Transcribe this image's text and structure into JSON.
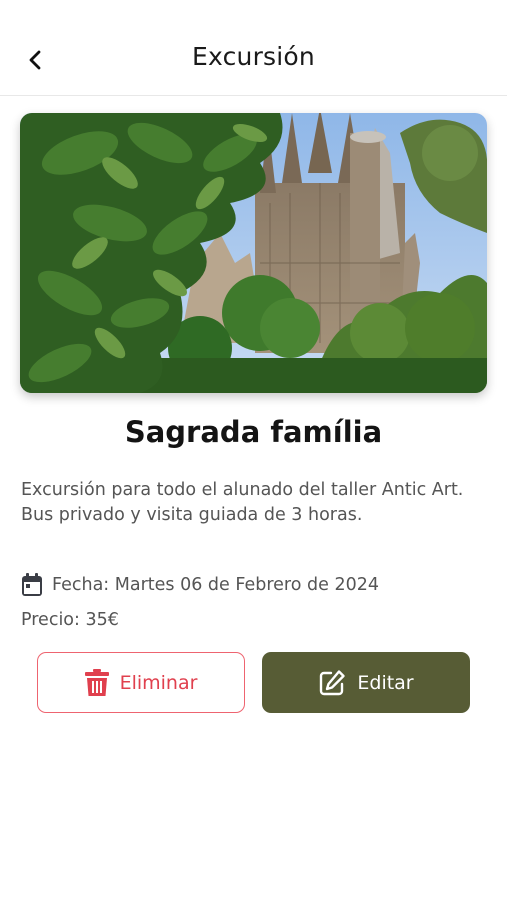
{
  "header": {
    "title": "Excursión",
    "back_icon": "chevron-left-icon"
  },
  "excursion": {
    "image_subject": "Sagrada família",
    "title": "Sagrada família",
    "description": "Excursión para todo el alunado del taller Antic Art. Bus privado y visita guiada de 3 horas.",
    "date_icon": "calendar-icon",
    "date_text": "Fecha: Martes 06 de Febrero de 2024",
    "price_text": "Precio: 35€"
  },
  "actions": {
    "delete_label": "Eliminar",
    "delete_icon": "trash-icon",
    "edit_label": "Editar",
    "edit_icon": "edit-icon"
  },
  "colors": {
    "accent_olive": "#575c35",
    "danger_red": "#e0404e",
    "danger_border": "#ee6470",
    "text_gray": "#555555"
  }
}
